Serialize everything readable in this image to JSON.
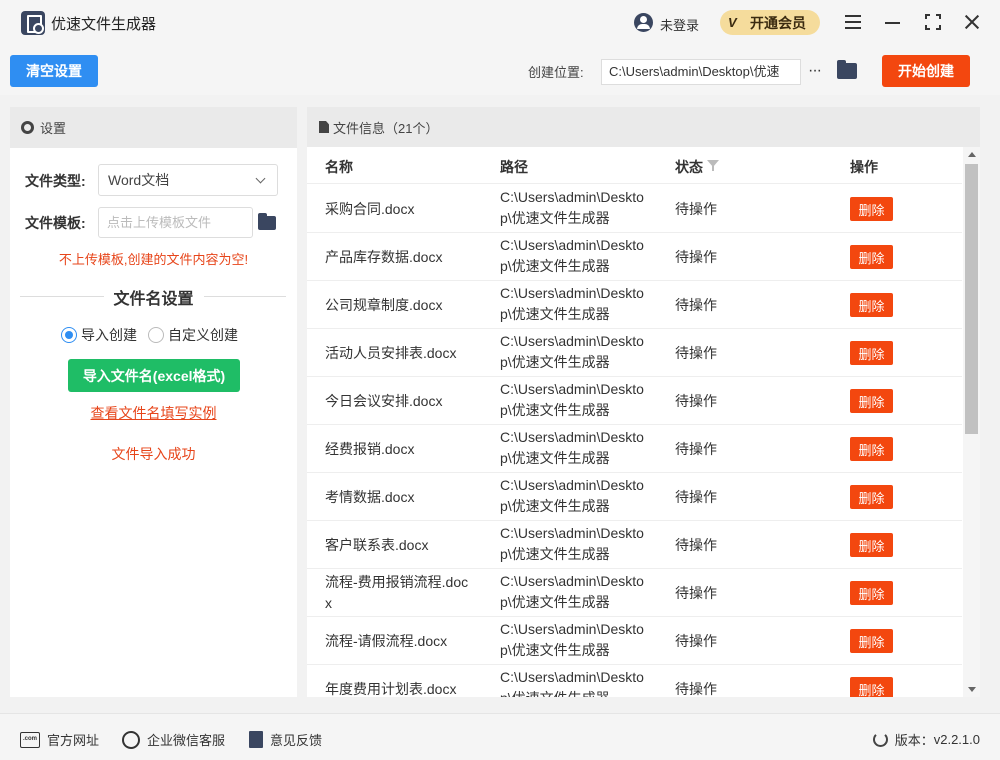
{
  "app": {
    "title": "优速文件生成器",
    "login_text": "未登录",
    "vip_icon_text": "V",
    "vip_text": "开通会员"
  },
  "toolbar": {
    "clear_label": "清空设置",
    "location_label": "创建位置:",
    "location_value": "C:\\Users\\admin\\Desktop\\优速",
    "more_label": "···",
    "start_label": "开始创建"
  },
  "settings": {
    "header": "设置",
    "file_type_label": "文件类型:",
    "file_type_value": "Word文档",
    "template_label": "文件模板:",
    "template_placeholder": "点击上传模板文件",
    "warning": "不上传模板,创建的文件内容为空!",
    "filename_section": "文件名设置",
    "radio_import": "导入创建",
    "radio_custom": "自定义创建",
    "import_button": "导入文件名(excel格式)",
    "example_link": "查看文件名填写实例",
    "import_status": "文件导入成功"
  },
  "file_info": {
    "header": "文件信息（21个）",
    "columns": {
      "name": "名称",
      "path": "路径",
      "status": "状态",
      "action": "操作"
    },
    "rows": [
      {
        "name": "采购合同.docx",
        "path": "C:\\Users\\admin\\Desktop\\优速文件生成器",
        "status": "待操作",
        "action": "删除"
      },
      {
        "name": "产品库存数据.docx",
        "path": "C:\\Users\\admin\\Desktop\\优速文件生成器",
        "status": "待操作",
        "action": "删除"
      },
      {
        "name": "公司规章制度.docx",
        "path": "C:\\Users\\admin\\Desktop\\优速文件生成器",
        "status": "待操作",
        "action": "删除"
      },
      {
        "name": "活动人员安排表.docx",
        "path": "C:\\Users\\admin\\Desktop\\优速文件生成器",
        "status": "待操作",
        "action": "删除"
      },
      {
        "name": "今日会议安排.docx",
        "path": "C:\\Users\\admin\\Desktop\\优速文件生成器",
        "status": "待操作",
        "action": "删除"
      },
      {
        "name": "经费报销.docx",
        "path": "C:\\Users\\admin\\Desktop\\优速文件生成器",
        "status": "待操作",
        "action": "删除"
      },
      {
        "name": "考情数据.docx",
        "path": "C:\\Users\\admin\\Desktop\\优速文件生成器",
        "status": "待操作",
        "action": "删除"
      },
      {
        "name": "客户联系表.docx",
        "path": "C:\\Users\\admin\\Desktop\\优速文件生成器",
        "status": "待操作",
        "action": "删除"
      },
      {
        "name": "流程-费用报销流程.docx",
        "path": "C:\\Users\\admin\\Desktop\\优速文件生成器",
        "status": "待操作",
        "action": "删除"
      },
      {
        "name": "流程-请假流程.docx",
        "path": "C:\\Users\\admin\\Desktop\\优速文件生成器",
        "status": "待操作",
        "action": "删除"
      },
      {
        "name": "年度费用计划表.docx",
        "path": "C:\\Users\\admin\\Desktop\\优速文件生成器",
        "status": "待操作",
        "action": "删除"
      }
    ]
  },
  "footer": {
    "website": "官方网址",
    "wechat": "企业微信客服",
    "feedback": "意见反馈",
    "website_icon_text": ".com",
    "version_label": "版本：",
    "version_value": "v2.2.1.0"
  },
  "colors": {
    "primary": "#2f8ef2",
    "danger": "#f3470f",
    "success": "#1fbd66",
    "warning_text": "#e7451a",
    "vip": "#f5dc9c"
  },
  "icons": [
    "app-logo-icon",
    "user-icon",
    "vip-icon",
    "menu-icon",
    "minimize-icon",
    "maximize-icon",
    "close-icon",
    "more-icon",
    "folder-icon",
    "gear-icon",
    "document-icon",
    "filter-icon",
    "web-icon",
    "wechat-icon",
    "feedback-icon",
    "refresh-icon"
  ]
}
